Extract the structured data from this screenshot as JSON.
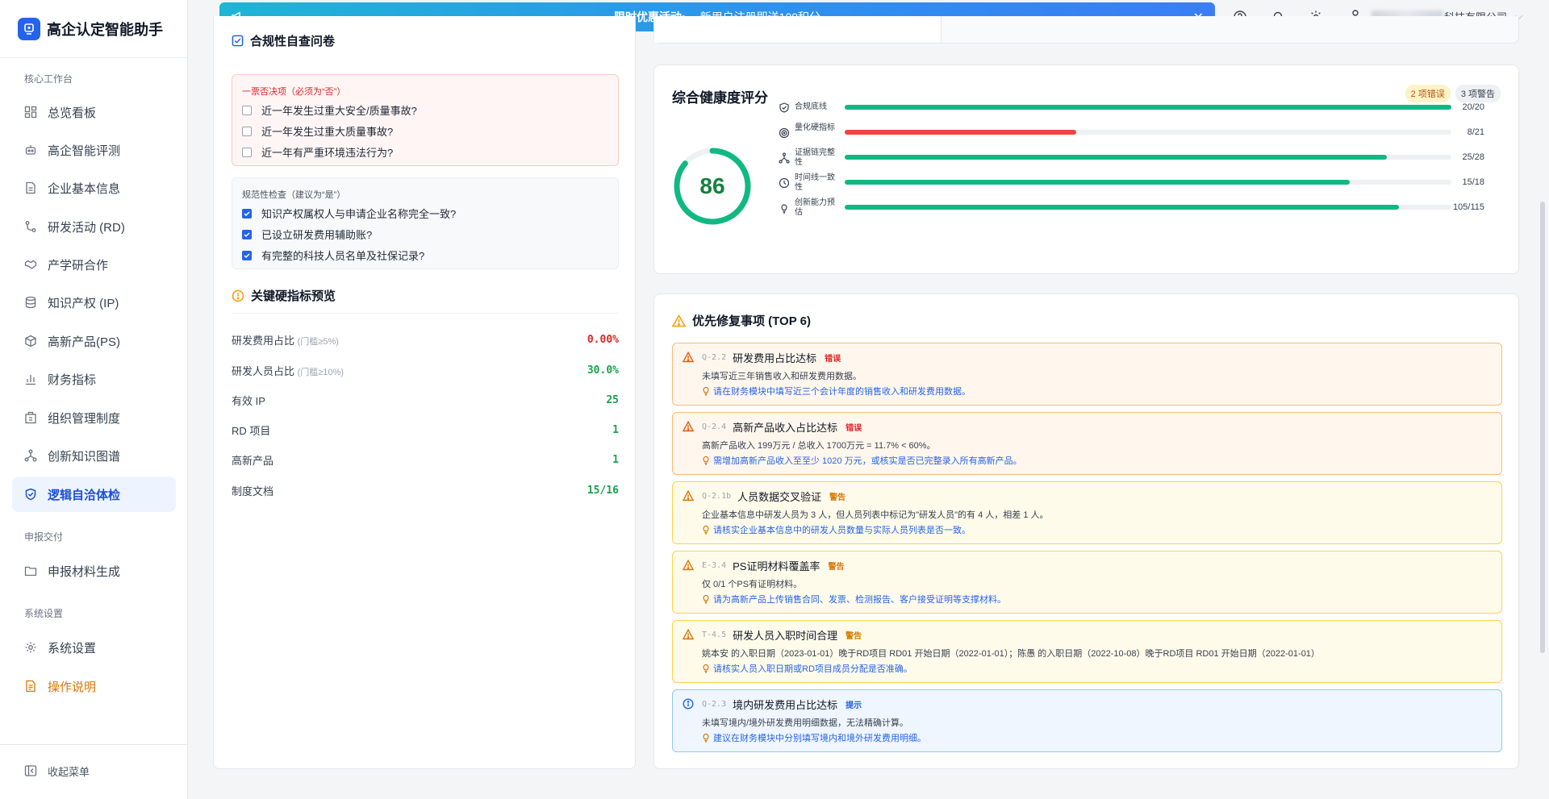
{
  "app": {
    "title": "高企认定智能助手"
  },
  "sidebar": {
    "section_core": "核心工作台",
    "section_submit": "申报交付",
    "section_settings": "系统设置",
    "items": [
      {
        "label": "总览看板",
        "icon": "dashboard-icon"
      },
      {
        "label": "高企智能评测",
        "icon": "robot-icon"
      },
      {
        "label": "企业基本信息",
        "icon": "document-icon"
      },
      {
        "label": "研发活动 (RD)",
        "icon": "branch-icon"
      },
      {
        "label": "产学研合作",
        "icon": "handshake-icon"
      },
      {
        "label": "知识产权 (IP)",
        "icon": "database-icon"
      },
      {
        "label": "高新产品(PS)",
        "icon": "box-icon"
      },
      {
        "label": "财务指标",
        "icon": "bar-chart-icon"
      },
      {
        "label": "组织管理制度",
        "icon": "building-icon"
      },
      {
        "label": "创新知识图谱",
        "icon": "graph-icon"
      },
      {
        "label": "逻辑自洽体检",
        "icon": "shield-check-icon"
      },
      {
        "label": "申报材料生成",
        "icon": "folder-icon"
      },
      {
        "label": "系统设置",
        "icon": "gear-icon"
      },
      {
        "label": "操作说明",
        "icon": "doc-help-icon"
      }
    ],
    "collapse_label": "收起菜单"
  },
  "banner": {
    "title": "限时优惠活动:",
    "text": "新用户注册即送100积分"
  },
  "header": {
    "company_suffix": "科技有限公司"
  },
  "questionnaire": {
    "title": "合规性自查问卷",
    "veto_label": "一票否决项（必须为“否”）",
    "veto_items": [
      "近一年发生过重大安全/质量事故?",
      "近一年发生过重大质量事故?",
      "近一年有严重环境违法行为?"
    ],
    "norm_label": "规范性检查（建议为“是”）",
    "norm_items": [
      "知识产权属权人与申请企业名称完全一致?",
      "已设立研发费用辅助账?",
      "有完整的科技人员名单及社保记录?"
    ]
  },
  "metrics": {
    "title": "关键硬指标预览",
    "rows": [
      {
        "label": "研发费用占比",
        "threshold": "(门槛≥5%)",
        "value": "0.00%",
        "status": "bad"
      },
      {
        "label": "研发人员占比",
        "threshold": "(门槛≥10%)",
        "value": "30.0%",
        "status": "ok"
      },
      {
        "label": "有效 IP",
        "threshold": "",
        "value": "25",
        "status": "ok"
      },
      {
        "label": "RD 项目",
        "threshold": "",
        "value": "1",
        "status": "ok"
      },
      {
        "label": "高新产品",
        "threshold": "",
        "value": "1",
        "status": "ok"
      },
      {
        "label": "制度文档",
        "threshold": "",
        "value": "15/16",
        "status": "ok"
      }
    ]
  },
  "health": {
    "title": "综合健康度评分",
    "errors_badge": "2 项错误",
    "warnings_badge": "3 项警告",
    "score": "86",
    "score_fraction": 0.86,
    "colors": {
      "ok": "#10b981",
      "bad": "#ef4444"
    },
    "bars": [
      {
        "label": "合规底线",
        "value": "20/20",
        "fraction": 1.0,
        "status": "ok",
        "icon": "shield-icon"
      },
      {
        "label": "量化硬指标",
        "value": "8/21",
        "fraction": 0.381,
        "status": "bad",
        "icon": "target-icon"
      },
      {
        "label": "证据链完整性",
        "value": "25/28",
        "fraction": 0.893,
        "status": "ok",
        "icon": "network-icon"
      },
      {
        "label": "时间线一致性",
        "value": "15/18",
        "fraction": 0.833,
        "status": "ok",
        "icon": "clock-icon"
      },
      {
        "label": "创新能力预估",
        "value": "105/115",
        "fraction": 0.913,
        "status": "ok",
        "icon": "bulb-icon"
      }
    ]
  },
  "fixes": {
    "title": "优先修复事项 (TOP 6)",
    "items": [
      {
        "code": "Q-2.2",
        "title": "研发费用占比达标",
        "tag": "错误",
        "level": "error",
        "desc": "未填写近三年销售收入和研发费用数据。",
        "suggestion": "请在财务模块中填写近三个会计年度的销售收入和研发费用数据。"
      },
      {
        "code": "Q-2.4",
        "title": "高新产品收入占比达标",
        "tag": "错误",
        "level": "error",
        "desc": "高新产品收入 199万元 / 总收入 1700万元 = 11.7% < 60%。",
        "suggestion": "需增加高新产品收入至至少 1020 万元，或核实是否已完整录入所有高新产品。"
      },
      {
        "code": "Q-2.1b",
        "title": "人员数据交叉验证",
        "tag": "警告",
        "level": "warning",
        "desc": "企业基本信息中研发人员为 3 人，但人员列表中标记为\"研发人员\"的有 4 人，相差 1 人。",
        "suggestion": "请核实企业基本信息中的研发人员数量与实际人员列表是否一致。"
      },
      {
        "code": "E-3.4",
        "title": "PS证明材料覆盖率",
        "tag": "警告",
        "level": "warning",
        "desc": "仅 0/1 个PS有证明材料。",
        "suggestion": "请为高新产品上传销售合同、发票、检测报告、客户接受证明等支撑材料。"
      },
      {
        "code": "T-4.5",
        "title": "研发人员入职时间合理",
        "tag": "警告",
        "level": "warning",
        "desc": "姚本安 的入职日期（2023-01-01）晚于RD项目 RD01 开始日期（2022-01-01）；陈愚 的入职日期（2022-10-08）晚于RD项目 RD01 开始日期（2022-01-01）",
        "suggestion": "请核实人员入职日期或RD项目成员分配是否准确。"
      },
      {
        "code": "Q-2.3",
        "title": "境内研发费用占比达标",
        "tag": "提示",
        "level": "info",
        "desc": "未填写境内/境外研发费用明细数据，无法精确计算。",
        "suggestion": "建议在财务模块中分别填写境内和境外研发费用明细。"
      }
    ]
  }
}
